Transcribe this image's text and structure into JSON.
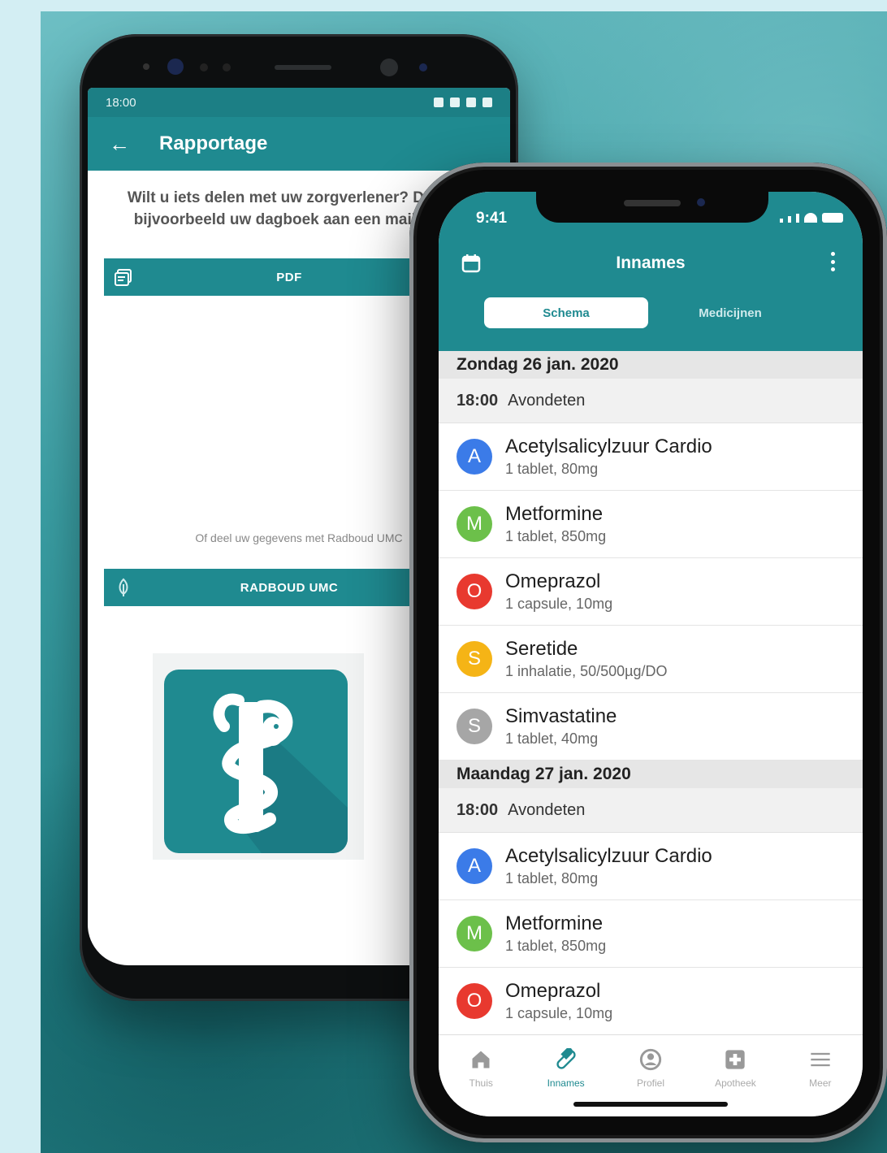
{
  "android": {
    "status_time": "18:00",
    "appbar_title": "Rapportage",
    "intro_text": "Wilt u iets delen met uw zorgverlener? Dit kan door bijvoorbeeld uw dagboek aan een mail te voegen.",
    "pdf_button": "PDF",
    "share_text": "Of deel uw gegevens met Radboud UMC",
    "radboud_button": "RADBOUD UMC"
  },
  "iphone": {
    "status_time": "9:41",
    "title": "Innames",
    "tabs": [
      "Schema",
      "Medicijnen"
    ],
    "days": [
      {
        "date": "Zondag 26 jan. 2020",
        "time": "18:00",
        "meal": "Avondeten",
        "meds": [
          {
            "initial": "A",
            "name": "Acetylsalicylzuur Cardio",
            "dose": "1 tablet, 80mg",
            "color": "#3b7be8"
          },
          {
            "initial": "M",
            "name": "Metformine",
            "dose": "1 tablet, 850mg",
            "color": "#6cc04a"
          },
          {
            "initial": "O",
            "name": "Omeprazol",
            "dose": "1 capsule, 10mg",
            "color": "#e8392f"
          },
          {
            "initial": "S",
            "name": "Seretide",
            "dose": "1 inhalatie, 50/500µg/DO",
            "color": "#f5b416"
          },
          {
            "initial": "S",
            "name": "Simvastatine",
            "dose": "1 tablet, 40mg",
            "color": "#a6a6a6"
          }
        ]
      },
      {
        "date": "Maandag 27 jan. 2020",
        "time": "18:00",
        "meal": "Avondeten",
        "meds": [
          {
            "initial": "A",
            "name": "Acetylsalicylzuur Cardio",
            "dose": "1 tablet, 80mg",
            "color": "#3b7be8"
          },
          {
            "initial": "M",
            "name": "Metformine",
            "dose": "1 tablet, 850mg",
            "color": "#6cc04a"
          },
          {
            "initial": "O",
            "name": "Omeprazol",
            "dose": "1 capsule, 10mg",
            "color": "#e8392f"
          }
        ]
      }
    ],
    "tabbar": [
      {
        "label": "Thuis",
        "icon": "home-icon",
        "active": false
      },
      {
        "label": "Innames",
        "icon": "pill-icon",
        "active": true
      },
      {
        "label": "Profiel",
        "icon": "profile-icon",
        "active": false
      },
      {
        "label": "Apotheek",
        "icon": "pharmacy-icon",
        "active": false
      },
      {
        "label": "Meer",
        "icon": "menu-icon",
        "active": false
      }
    ]
  },
  "colors": {
    "brand": "#1f8a90"
  }
}
